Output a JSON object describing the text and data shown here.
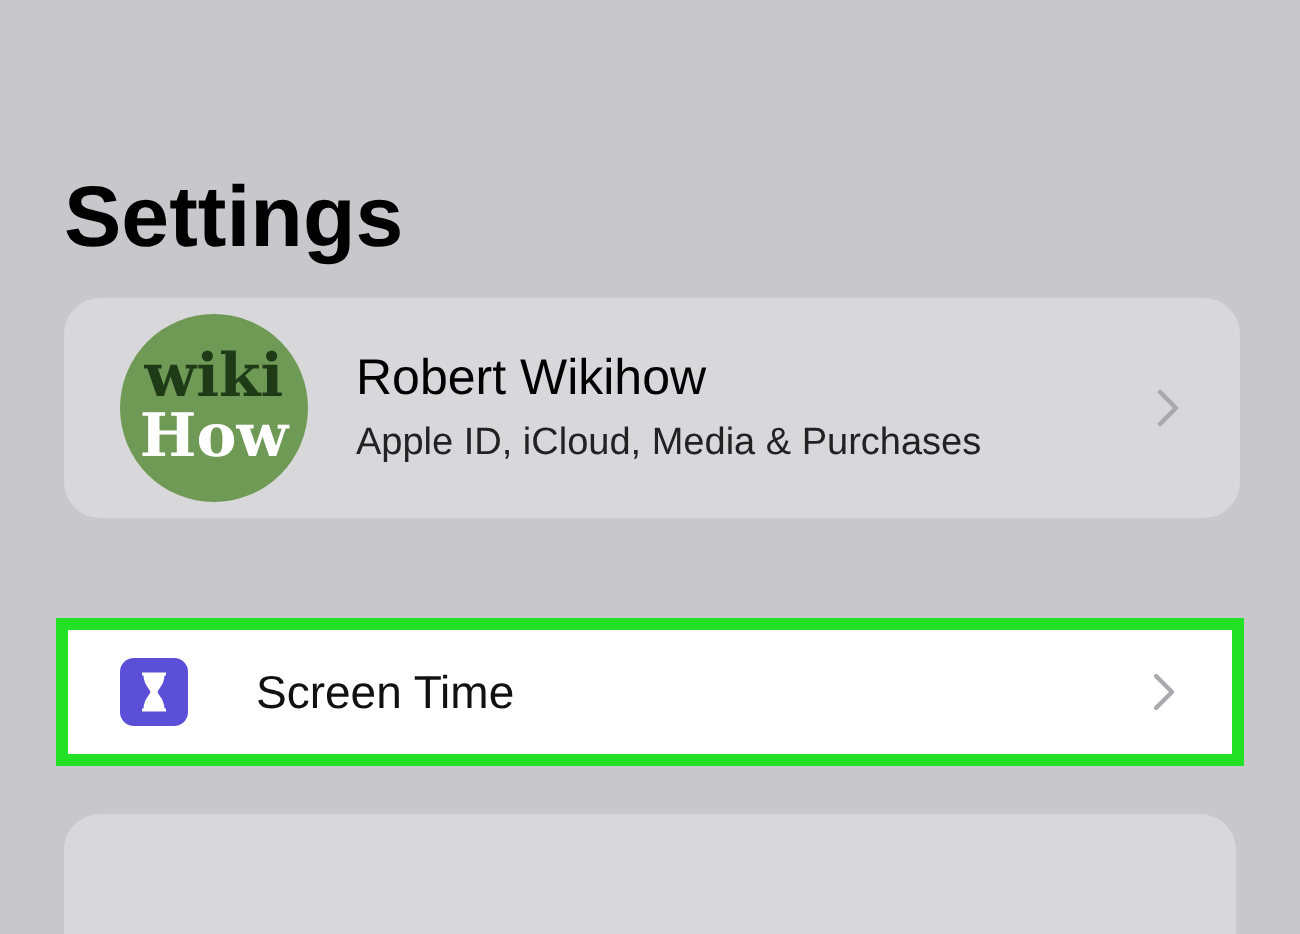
{
  "title": "Settings",
  "profile": {
    "avatar_text": [
      "wiki",
      "How"
    ],
    "name": "Robert Wikihow",
    "subtitle": "Apple ID, iCloud, Media & Purchases"
  },
  "rows": [
    {
      "label": "Screen Time",
      "highlighted": true
    }
  ]
}
